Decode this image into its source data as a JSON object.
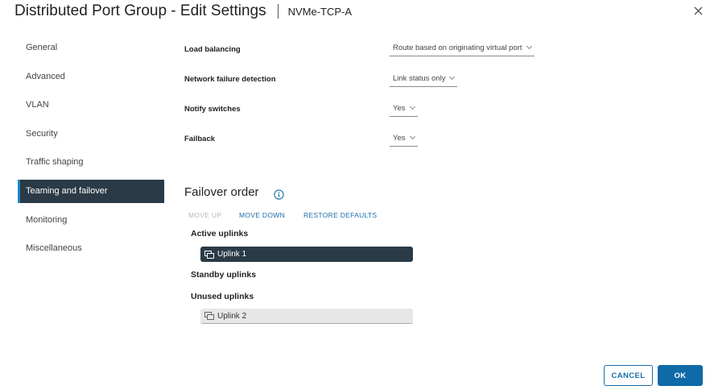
{
  "header": {
    "title": "Distributed Port Group - Edit Settings",
    "subtitle": "NVMe-TCP-A",
    "close_icon": "close-icon"
  },
  "sidebar": {
    "items": [
      {
        "label": "General",
        "active": false
      },
      {
        "label": "Advanced",
        "active": false
      },
      {
        "label": "VLAN",
        "active": false
      },
      {
        "label": "Security",
        "active": false
      },
      {
        "label": "Traffic shaping",
        "active": false
      },
      {
        "label": "Teaming and failover",
        "active": true
      },
      {
        "label": "Monitoring",
        "active": false
      },
      {
        "label": "Miscellaneous",
        "active": false
      }
    ]
  },
  "settings": {
    "load_balancing": {
      "label": "Load balancing",
      "value": "Route based on originating virtual port"
    },
    "network_failure_detection": {
      "label": "Network failure detection",
      "value": "Link status only"
    },
    "notify_switches": {
      "label": "Notify switches",
      "value": "Yes"
    },
    "failback": {
      "label": "Failback",
      "value": "Yes"
    }
  },
  "failover": {
    "title": "Failover order",
    "move_up": "MOVE UP",
    "move_down": "MOVE DOWN",
    "restore_defaults": "RESTORE DEFAULTS",
    "active_label": "Active uplinks",
    "active": [
      "Uplink 1"
    ],
    "standby_label": "Standby uplinks",
    "standby": [],
    "unused_label": "Unused uplinks",
    "unused": [
      "Uplink 2"
    ]
  },
  "footer": {
    "cancel": "CANCEL",
    "ok": "OK"
  },
  "colors": {
    "accent": "#1a6da8",
    "primary_button": "#0f6aa8",
    "nav_active": "#2a3a46"
  }
}
